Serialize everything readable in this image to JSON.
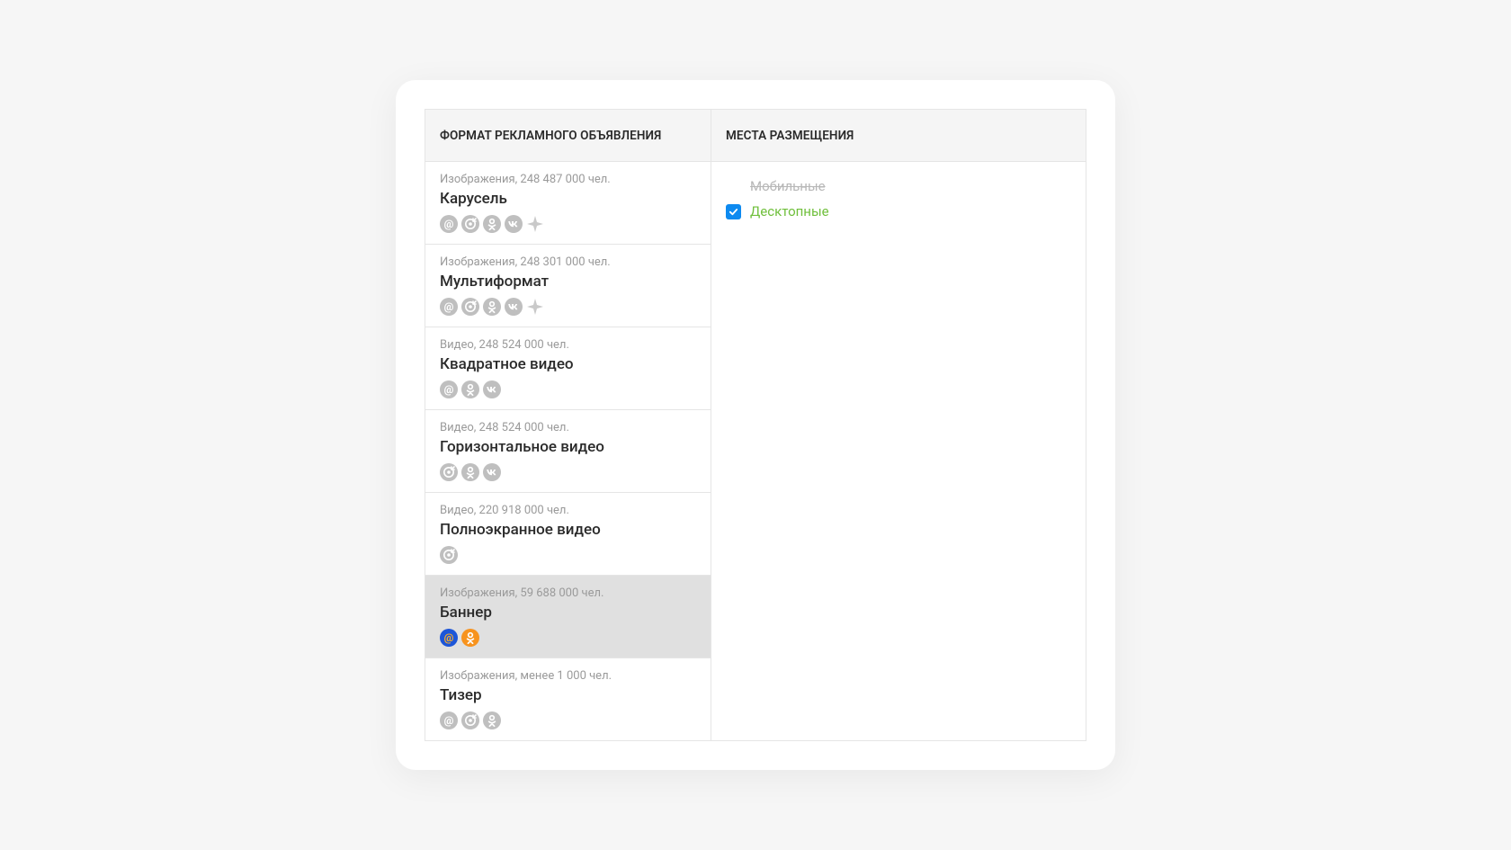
{
  "headers": {
    "format": "ФОРМАТ РЕКЛАМНОГО ОБЪЯВЛЕНИЯ",
    "placements": "МЕСТА РАЗМЕЩЕНИЯ"
  },
  "formats": [
    {
      "meta": "Изображения, 248 487 000 чел.",
      "title": "Карусель",
      "icons": [
        "mail",
        "target",
        "ok",
        "vk",
        "spark"
      ],
      "selected": false
    },
    {
      "meta": "Изображения, 248 301 000 чел.",
      "title": "Мультиформат",
      "icons": [
        "mail",
        "target",
        "ok",
        "vk",
        "spark"
      ],
      "selected": false
    },
    {
      "meta": "Видео, 248 524 000 чел.",
      "title": "Квадратное видео",
      "icons": [
        "mail",
        "ok",
        "vk"
      ],
      "selected": false
    },
    {
      "meta": "Видео, 248 524 000 чел.",
      "title": "Горизонтальное видео",
      "icons": [
        "target",
        "ok",
        "vk"
      ],
      "selected": false
    },
    {
      "meta": "Видео, 220 918 000 чел.",
      "title": "Полноэкранное видео",
      "icons": [
        "target"
      ],
      "selected": false
    },
    {
      "meta": "Изображения, 59 688 000 чел.",
      "title": "Баннер",
      "icons": [
        "mail-color",
        "ok-color"
      ],
      "selected": true
    },
    {
      "meta": "Изображения, менее 1 000 чел.",
      "title": "Тизер",
      "icons": [
        "mail",
        "target",
        "ok"
      ],
      "selected": false
    }
  ],
  "placements": [
    {
      "label": "Мобильные",
      "state": "disabled"
    },
    {
      "label": "Десктопные",
      "state": "checked"
    }
  ]
}
